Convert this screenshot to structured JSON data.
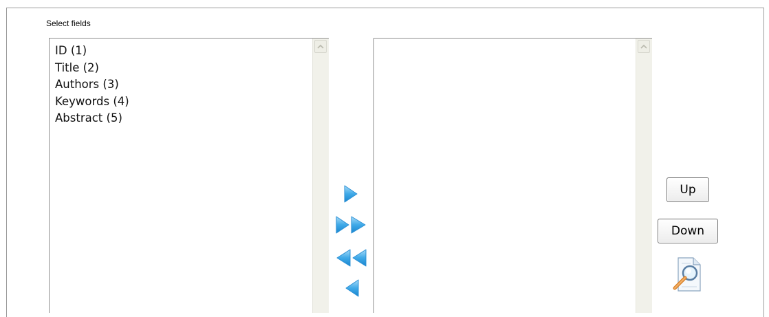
{
  "panel": {
    "label": "Select fields"
  },
  "available_fields": {
    "items": [
      "ID (1)",
      "Title (2)",
      "Authors (3)",
      "Keywords (4)",
      "Abstract (5)"
    ]
  },
  "selected_fields": {
    "items": []
  },
  "controls": {
    "add": "arrow-right-icon",
    "add_all": "double-arrow-right-icon",
    "remove_all": "double-arrow-left-icon",
    "remove": "arrow-left-icon",
    "preview": "magnifier-document-icon"
  },
  "buttons": {
    "up_label": "Up",
    "down_label": "Down"
  },
  "colors": {
    "arrow_fill": "#3fa9e8",
    "arrow_highlight": "#a8dcf8",
    "border": "#8d8d8d",
    "scroll_track": "#f1f1ea"
  }
}
